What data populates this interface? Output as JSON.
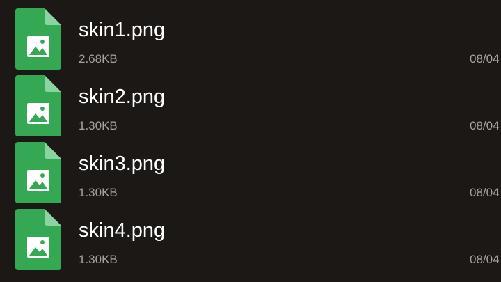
{
  "files": [
    {
      "name": "skin1.png",
      "size": "2.68KB",
      "date": "08/04",
      "icon": "image-file-icon"
    },
    {
      "name": "skin2.png",
      "size": "1.30KB",
      "date": "08/04",
      "icon": "image-file-icon"
    },
    {
      "name": "skin3.png",
      "size": "1.30KB",
      "date": "08/04",
      "icon": "image-file-icon"
    },
    {
      "name": "skin4.png",
      "size": "1.30KB",
      "date": "08/04",
      "icon": "image-file-icon"
    }
  ],
  "colors": {
    "background": "#1b1816",
    "icon_green": "#34a853",
    "icon_fold": "#8bd3a0",
    "name_text": "#ffffff",
    "meta_text": "#a6a3a1"
  }
}
